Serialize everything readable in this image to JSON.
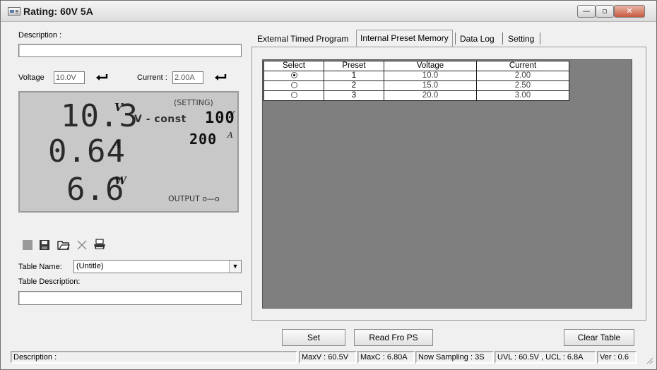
{
  "window": {
    "title": "Rating: 60V 5A",
    "min_glyph": "—",
    "max_glyph": "▫",
    "close_glyph": "✕"
  },
  "left": {
    "description_label": "Description :",
    "description_value": "",
    "voltage_label": "Voltage",
    "voltage_value": "10.0V",
    "current_label": "Current :",
    "current_value": "2.00A",
    "table_name_label": "Table Name:",
    "table_name_value": "(Untitle)",
    "table_desc_label": "Table Description:",
    "table_desc_value": ""
  },
  "lcd": {
    "voltage": "10.3",
    "voltage_unit": "V",
    "current": "0.64",
    "current_unit": "A",
    "power": "6.6",
    "power_unit": "W",
    "setting_label": "(SETTING)",
    "mode": "V - const",
    "set_voltage": "100",
    "set_voltage_unit": "V",
    "set_current": "200",
    "set_current_unit": "A",
    "output_label": "OUTPUT o—o"
  },
  "toolbar": {
    "icons": [
      "new-icon",
      "save-icon",
      "open-folder-icon",
      "delete-icon",
      "print-icon"
    ]
  },
  "tabs": [
    {
      "label": "External Timed Program",
      "active": false
    },
    {
      "label": "Internal Preset Memory",
      "active": true
    },
    {
      "label": "Data Log",
      "active": false
    },
    {
      "label": "Setting",
      "active": false
    }
  ],
  "preset_table": {
    "headers": [
      "Select",
      "Preset",
      "Voltage",
      "Current"
    ],
    "rows": [
      {
        "selected": true,
        "preset": "1",
        "voltage": "10.0",
        "current": "2.00"
      },
      {
        "selected": false,
        "preset": "2",
        "voltage": "15.0",
        "current": "2.50"
      },
      {
        "selected": false,
        "preset": "3",
        "voltage": "20.0",
        "current": "3.00"
      }
    ]
  },
  "buttons": {
    "set": "Set",
    "read": "Read Fro PS",
    "clear": "Clear Table"
  },
  "status": {
    "description": "Description :",
    "maxv": "MaxV : 60.5V",
    "maxc": "MaxC : 6.80A",
    "sampling": "Now Sampling : 3S",
    "limits": "UVL : 60.5V , UCL : 6.8A",
    "version": "Ver : 0.6"
  },
  "colors": {
    "grid_background": "#7f7f7f",
    "lcd_background": "#c8c8c8",
    "window_background": "#f0f0f0"
  }
}
